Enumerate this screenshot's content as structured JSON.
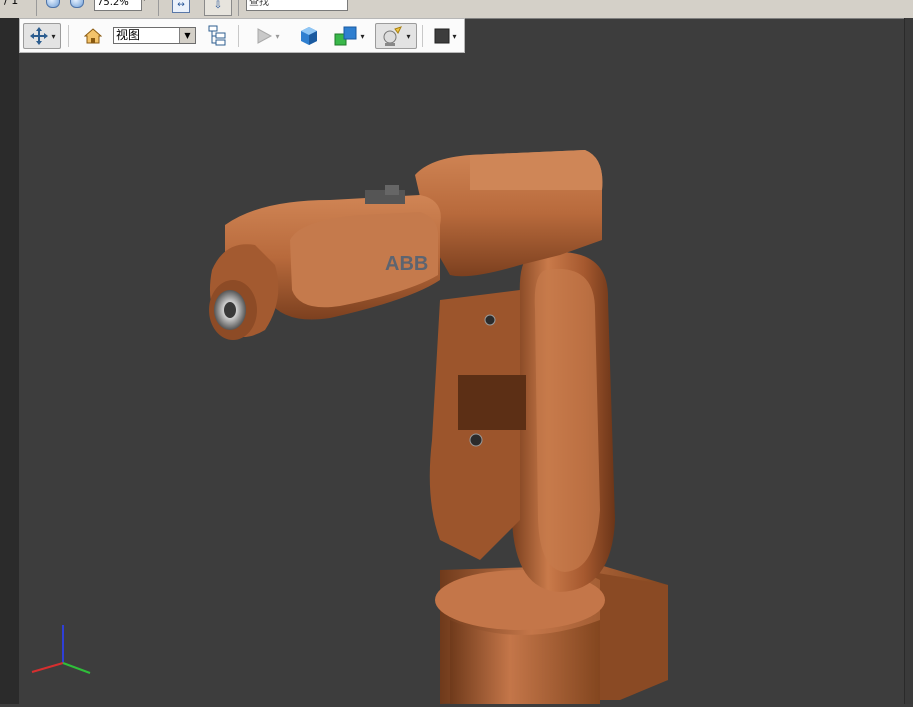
{
  "topbar": {
    "page_indicator": "/ 1",
    "zoom_value": "75.2%",
    "find_placeholder": "查找"
  },
  "toolbar": {
    "view_select_value": "视图",
    "icons": [
      "navigate-icon",
      "home-icon",
      "model-tree-icon",
      "play-icon",
      "cube-icon",
      "multi-cube-icon",
      "lighting-icon",
      "background-color-icon"
    ]
  },
  "scene": {
    "robot_logo_text": "ABB",
    "robot_color": "#c97a4a",
    "background_color": "#3d3d3d",
    "axes": [
      "z",
      "x",
      "y"
    ]
  }
}
